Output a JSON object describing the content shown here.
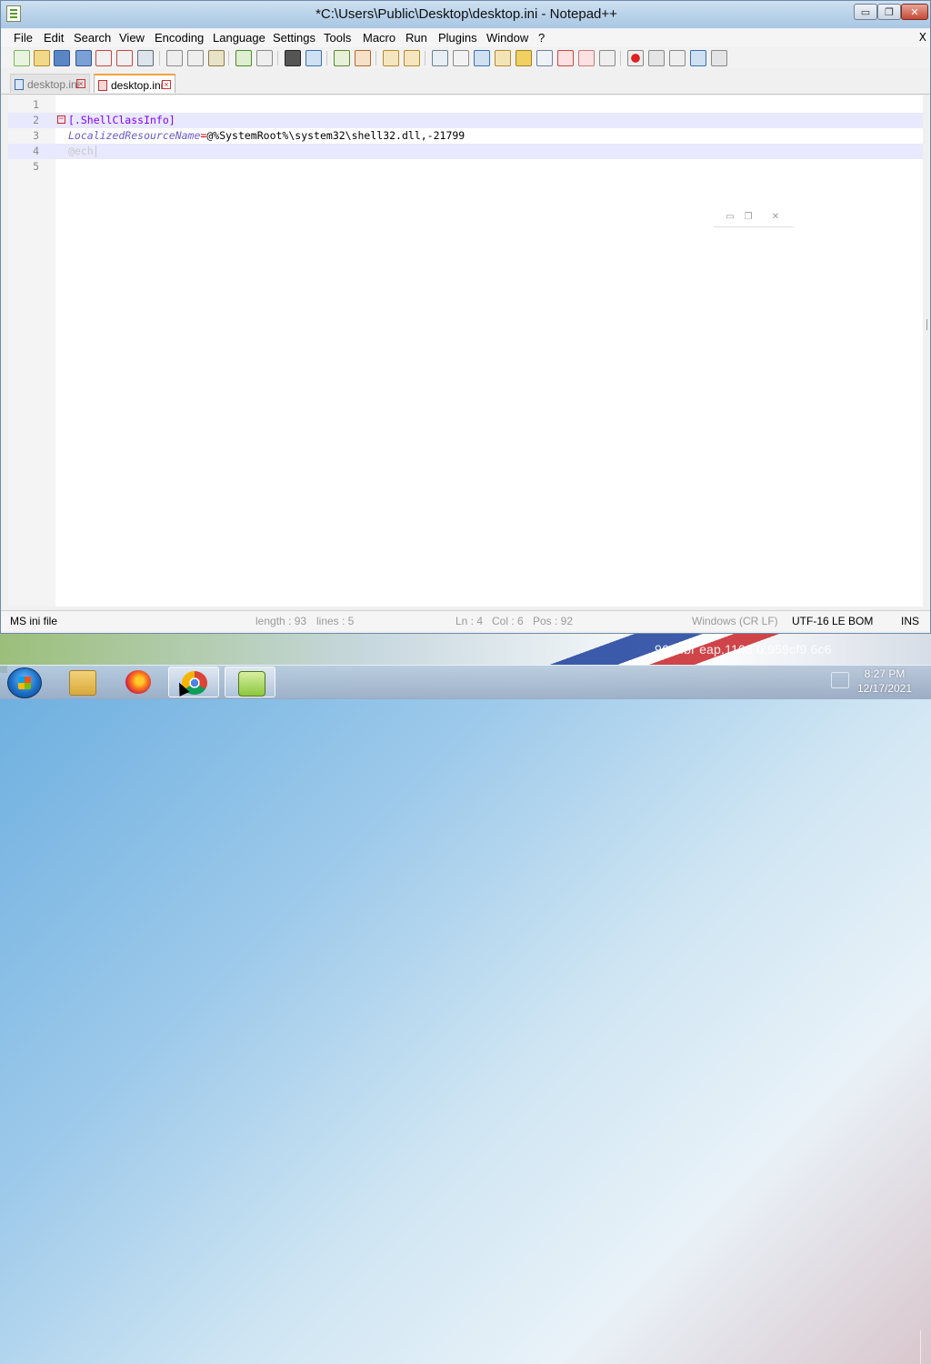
{
  "window": {
    "title": "*C:\\Users\\Public\\Desktop\\desktop.ini - Notepad++",
    "controls": {
      "minimize": "▭",
      "maximize": "❐",
      "close": "✕"
    }
  },
  "menubar": {
    "items": [
      "File",
      "Edit",
      "Search",
      "View",
      "Encoding",
      "Language",
      "Settings",
      "Tools",
      "Macro",
      "Run",
      "Plugins",
      "Window",
      "?"
    ],
    "close_glyph": "X"
  },
  "tabs": [
    {
      "label": "desktop.ini",
      "active": false
    },
    {
      "label": "desktop.ini",
      "active": true
    }
  ],
  "editor": {
    "lines": [
      {
        "num": "1",
        "parts": []
      },
      {
        "num": "2",
        "section": "[.ShellClassInfo]"
      },
      {
        "num": "3",
        "key": "LocalizedResourceName",
        "eq": "=",
        "value": "@%SystemRoot%\\system32\\shell32.dll,-21799"
      },
      {
        "num": "4",
        "ghost": "@ech"
      },
      {
        "num": "5",
        "parts": []
      }
    ],
    "colors": {
      "section": "#8000ff",
      "key": "#6a5acd",
      "eq": "#d00000",
      "line_highlight": "#e8e8ff"
    }
  },
  "statusbar": {
    "file_type": "MS ini file",
    "length": "length : 93",
    "lines": "lines : 5",
    "ln": "Ln : 4",
    "col": "Col : 6",
    "pos": "Pos : 92",
    "eol": "Windows (CR LF)",
    "encoding": "UTF-16 LE BOM",
    "mode": "INS"
  },
  "desktop": {
    "background_text": "964.fbr  eap.1108       0.959cf9        6c6"
  },
  "taskbar": {
    "apps": [
      {
        "name": "Windows Explorer",
        "icon": "folder-icon"
      },
      {
        "name": "Firefox",
        "icon": "firefox-icon"
      },
      {
        "name": "Chrome",
        "icon": "chrome-icon",
        "active": true
      },
      {
        "name": "Notepad++",
        "icon": "notepadpp-icon"
      }
    ],
    "clock_time": "8:27 PM",
    "clock_date": "12/17/2021"
  }
}
